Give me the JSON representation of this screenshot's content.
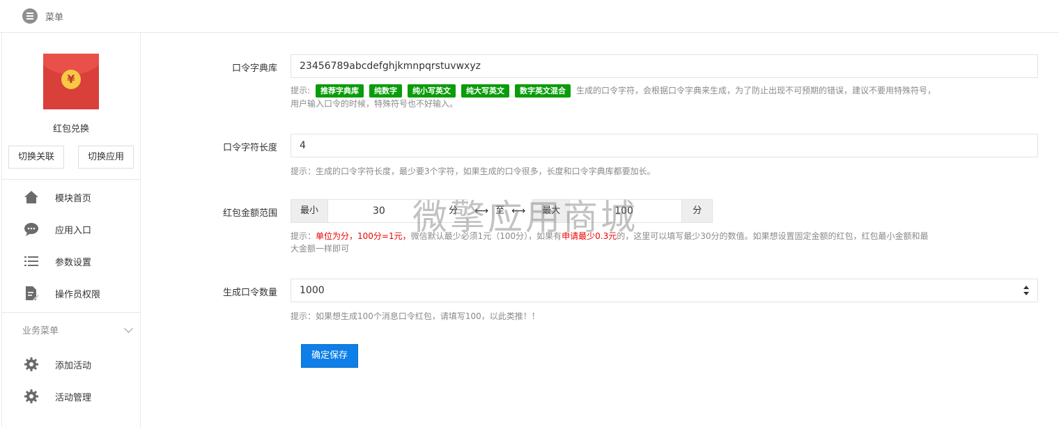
{
  "topbar": {
    "menu_label": "菜单"
  },
  "app": {
    "name": "红包兑换",
    "coin_symbol": "¥",
    "switch_relation": "切换关联",
    "switch_app": "切换应用"
  },
  "nav": [
    {
      "label": "模块首页",
      "icon": "home-icon"
    },
    {
      "label": "应用入口",
      "icon": "chat-icon"
    },
    {
      "label": "参数设置",
      "icon": "list-icon"
    },
    {
      "label": "操作员权限",
      "icon": "edit-doc-icon"
    }
  ],
  "business": {
    "title": "业务菜单",
    "items": [
      {
        "label": "添加活动",
        "icon": "gear-icon"
      },
      {
        "label": "活动管理",
        "icon": "gear-icon"
      }
    ]
  },
  "form": {
    "dict": {
      "label": "口令字典库",
      "value": "23456789abcdefghjkmnpqrstuvwxyz",
      "hint_prefix": "提示:",
      "tags": [
        "推荐字典库",
        "纯数字",
        "纯小写英文",
        "纯大写英文",
        "数字英文混合"
      ],
      "hint_text": "生成的口令字符，会根据口令字典来生成，为了防止出现不可预期的错误，建议不要用特殊符号，",
      "hint_text2": "用户输入口令的时候，特殊符号也不好输入。"
    },
    "length": {
      "label": "口令字符长度",
      "value": "4",
      "hint": "提示：生成的口令字符长度，最少要3个字符，如果生成的口令很多，长度和口令字典库都要加长。"
    },
    "amount": {
      "label": "红包金额范围",
      "min_label": "最小",
      "min_value": "30",
      "unit": "分",
      "to_label": "至",
      "max_label": "最大",
      "max_value": "100",
      "max_unit": "分",
      "hint_1": "提示：",
      "hint_red_1": "单位为分，100分=1元，",
      "hint_2": "微信默认最少必须1元（100分），如果有",
      "hint_red_2": "申请最少0.3元",
      "hint_3": "的，这里可以填写最少30分的数值。如果想设置固定金额的红包，红包最小金额和最",
      "hint_4": "大金额一样即可"
    },
    "count": {
      "label": "生成口令数量",
      "value": "1000",
      "hint": "提示：如果想生成100个消息口令红包，请填写100，以此类推！！"
    },
    "save_label": "确定保存"
  },
  "watermark": "微擎应用商城",
  "colors": {
    "primary": "#0e7fe8",
    "tag_green": "#0a9c0a",
    "red": "#e00000",
    "redpack": "#d9403a"
  }
}
